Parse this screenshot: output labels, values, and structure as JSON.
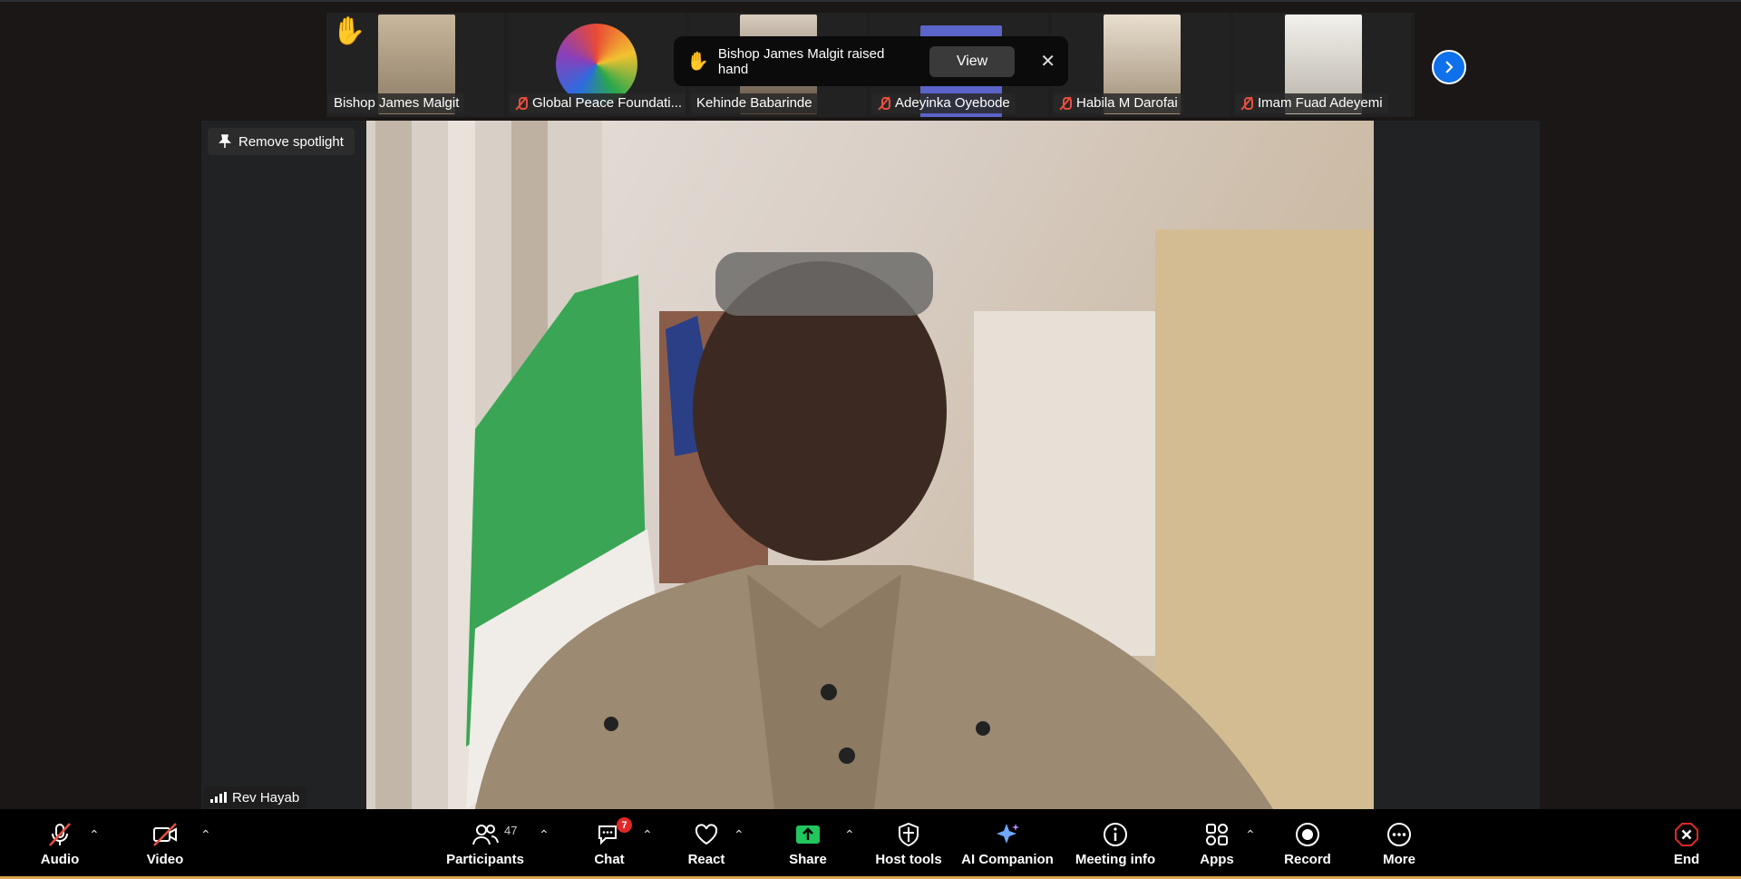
{
  "participants_strip": [
    {
      "name": "Bishop James Malgit",
      "muted": false,
      "raised_hand": true,
      "bg": "#b7a58a"
    },
    {
      "name": "Global Peace Foundati...",
      "muted": true,
      "raised_hand": false,
      "bg": "#101010"
    },
    {
      "name": "Kehinde Babarinde",
      "muted": false,
      "raised_hand": false,
      "bg": "#7a6552"
    },
    {
      "name": "Adeyinka Oyebode",
      "muted": true,
      "raised_hand": false,
      "bg": "#5b64c8"
    },
    {
      "name": "Habila M Darofai",
      "muted": true,
      "raised_hand": false,
      "bg": "#d6c7b1"
    },
    {
      "name": "Imam Fuad Adeyemi",
      "muted": true,
      "raised_hand": false,
      "bg": "#d9d6d0"
    }
  ],
  "toast": {
    "message": "Bishop James Malgit raised hand",
    "view_label": "View",
    "close_label": "✕"
  },
  "stage": {
    "remove_spotlight_label": "Remove spotlight",
    "active_speaker": "Rev Hayab"
  },
  "toolbar": {
    "audio": "Audio",
    "video": "Video",
    "participants": "Participants",
    "participants_count": "47",
    "chat": "Chat",
    "chat_badge": "7",
    "react": "React",
    "share": "Share",
    "host_tools": "Host tools",
    "ai_companion": "AI Companion",
    "meeting_info": "Meeting info",
    "apps": "Apps",
    "record": "Record",
    "more": "More",
    "end": "End"
  },
  "colors": {
    "accent_blue": "#0e71eb",
    "share_green": "#22c55e",
    "mute_red": "#e84f3f",
    "end_red": "#e02828"
  }
}
